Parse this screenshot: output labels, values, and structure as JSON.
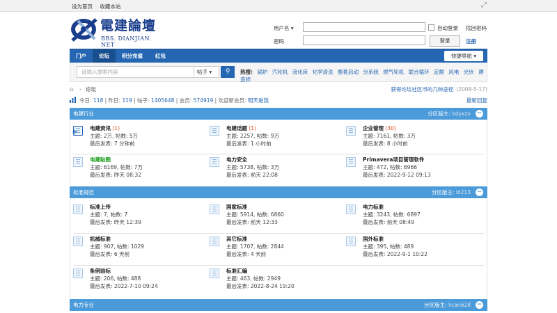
{
  "topbar": {
    "set_home": "设为首页",
    "bookmark": "收藏本站"
  },
  "logo": {
    "main": "電建論壇",
    "sub": "BBS. DIANJIAN. NET"
  },
  "login": {
    "username_label": "用户名 ▾",
    "password_label": "密码",
    "auto_login": "自动登录",
    "forgot": "找回密码",
    "login_button": "登录",
    "register": "注册"
  },
  "nav": {
    "items": [
      "门户",
      "论坛",
      "积分充值",
      "红包"
    ],
    "quick": "快捷导航 ▾"
  },
  "search": {
    "placeholder": "请输入搜索内容",
    "type": "帖子 ▾",
    "hot_label": "热搜:",
    "hot_terms": [
      "锅炉",
      "汽轮机",
      "流化床",
      "化学清洗",
      "整套启动",
      "分系统",
      "燃气轮机",
      "联合循环",
      "定额",
      "风电",
      "光伏",
      "建造师"
    ]
  },
  "breadcrumb": {
    "current": "论坛",
    "news": "获得论坛社区币的几种途径",
    "news_date": "(2008-5-17)"
  },
  "stats": {
    "text_today": "今日: ",
    "today": "118",
    "text_yesterday": " | 昨日: ",
    "yesterday": "119",
    "text_posts": " | 帖子: ",
    "posts": "1405648",
    "text_members": " | 会员: ",
    "members": "574919",
    "text_welcome": " | 欢迎新会员: ",
    "newest": "明天是我",
    "latest_reply": "最新回复"
  },
  "sections": [
    {
      "title": "电建行业",
      "moderator_label": "分区版主: ",
      "moderator": "bdyxzx",
      "forums": [
        {
          "name": "电建资讯",
          "count": " (1)",
          "meta1": "主题: 2万, 帖数: 5万",
          "meta2": "最后发表: 7 分钟前"
        },
        {
          "name": "电建话题",
          "count": " (1)",
          "meta1": "主题: 2257, 帖数: 9万",
          "meta2": "最后发表: 1 小时前"
        },
        {
          "name": "企业管理",
          "count": " (30)",
          "meta1": "主题: 7161, 帖数: 3万",
          "meta2": "最后发表: 8 小时前"
        },
        {
          "name": "电建贴图",
          "count": "",
          "meta1": "主题: 6169, 帖数: 7万",
          "meta2": "最后发表: 昨天 08:32"
        },
        {
          "name": "电力安全",
          "count": "",
          "meta1": "主题: 5738, 帖数: 3万",
          "meta2": "最后发表: 前天 22:08"
        },
        {
          "name": "Primavera项目管理软件",
          "count": "",
          "meta1": "主题: 472, 帖数: 6966",
          "meta2": "最后发表: 2022-9-12 09:13"
        }
      ]
    },
    {
      "title": "标准规范",
      "moderator_label": "分区版主: ",
      "moderator": "ld213",
      "forums": [
        {
          "name": "标准上传",
          "count": "",
          "meta1": "主题: 7, 帖数: 7",
          "meta2": "最后发表: 昨天 12:39"
        },
        {
          "name": "国家标准",
          "count": "",
          "meta1": "主题: 5914, 帖数: 6860",
          "meta2": "最后发表: 前天 12:33"
        },
        {
          "name": "电力标准",
          "count": "",
          "meta1": "主题: 3243, 帖数: 6897",
          "meta2": "最后发表: 前天 08:49"
        },
        {
          "name": "机械标准",
          "count": "",
          "meta1": "主题: 907, 帖数: 1029",
          "meta2": "最后发表: 6 天前"
        },
        {
          "name": "其它标准",
          "count": "",
          "meta1": "主题: 1707, 帖数: 2844",
          "meta2": "最后发表: 4 天前"
        },
        {
          "name": "国外标准",
          "count": "",
          "meta1": "主题: 395, 帖数: 489",
          "meta2": "最后发表: 2022-9-1 10:22"
        },
        {
          "name": "条例验标",
          "count": "",
          "meta1": "主题: 206, 帖数: 488",
          "meta2": "最后发表: 2022-7-10 09:24"
        },
        {
          "name": "标准汇编",
          "count": "",
          "meta1": "主题: 463, 帖数: 2949",
          "meta2": "最后发表: 2022-8-24 19:20"
        }
      ]
    },
    {
      "title": "电力专业",
      "moderator_label": "分区版主: ",
      "moderator": "lican628"
    }
  ],
  "colors": {
    "accent": "#2566b3",
    "section_header": "#4b9ad9",
    "highlight_count": "#e04b1d",
    "green_title": "#1a9b1a"
  }
}
